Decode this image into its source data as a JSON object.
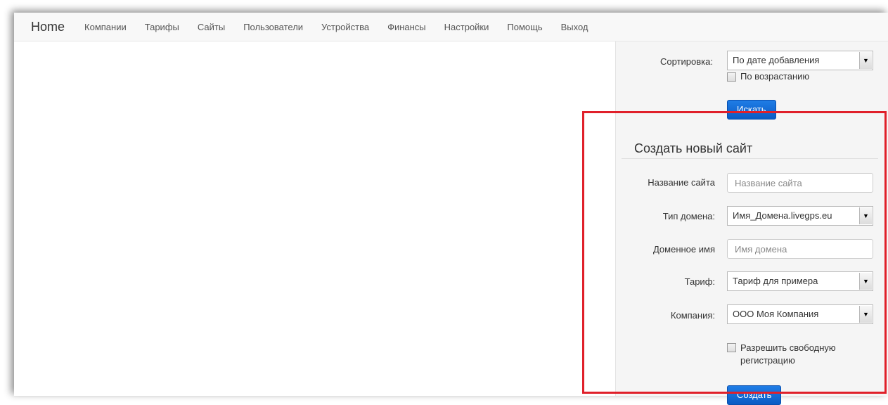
{
  "navbar": {
    "brand": "Home",
    "items": [
      "Компании",
      "Тарифы",
      "Сайты",
      "Пользователи",
      "Устройства",
      "Финансы",
      "Настройки",
      "Помощь",
      "Выход"
    ]
  },
  "search": {
    "sort_label": "Сортировка:",
    "sort_value": "По дате добавления",
    "ascending_label": "По возрастанию",
    "search_button": "Искать"
  },
  "create_site": {
    "title": "Создать новый сайт",
    "site_name_label": "Название сайта",
    "site_name_placeholder": "Название сайта",
    "domain_type_label": "Тип домена:",
    "domain_type_value": "Имя_Домена.livegps.eu",
    "domain_name_label": "Доменное имя",
    "domain_name_placeholder": "Имя домена",
    "tariff_label": "Тариф:",
    "tariff_value": "Тариф для примера",
    "company_label": "Компания:",
    "company_value": "ООО Моя Компания",
    "free_registration_label": "Разрешить свободную регистрацию",
    "create_button": "Создать"
  },
  "colors": {
    "highlight": "#e0202a",
    "button_blue": "#0a5bc4"
  },
  "icons": {
    "dropdown": "chevron-down-icon",
    "checkbox": "checkbox-icon"
  }
}
